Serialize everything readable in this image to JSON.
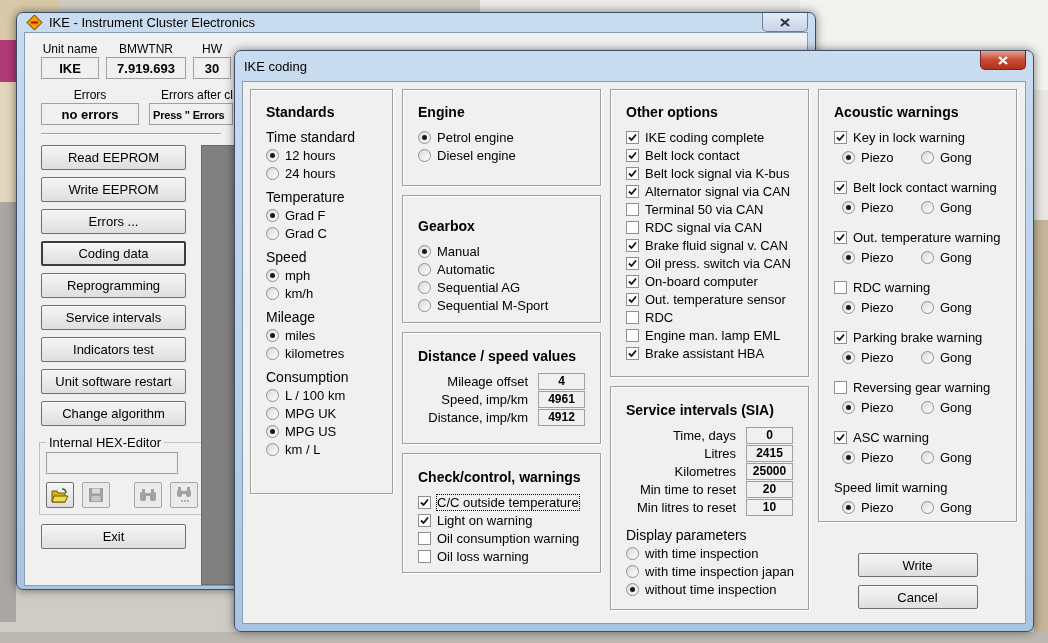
{
  "background_window": {
    "title": "IKE - Instrument Cluster Electronics",
    "info": [
      {
        "label": "Unit name",
        "value": "IKE"
      },
      {
        "label": "BMWTNR",
        "value": "7.919.693"
      },
      {
        "label": "HW",
        "value": "30"
      }
    ],
    "errors": [
      {
        "label": "Errors",
        "value": "no errors"
      },
      {
        "label": "Errors after cl",
        "value": "Press \" Errors"
      }
    ],
    "buttons": [
      {
        "label": "Read EEPROM",
        "focused": false
      },
      {
        "label": "Write EEPROM",
        "focused": false
      },
      {
        "label": "Errors ...",
        "focused": false
      },
      {
        "label": "Coding data",
        "focused": true
      },
      {
        "label": "Reprogramming",
        "focused": false
      },
      {
        "label": "Service intervals",
        "focused": false
      },
      {
        "label": "Indicators test",
        "focused": false
      },
      {
        "label": "Unit software restart",
        "focused": false
      },
      {
        "label": "Change algorithm",
        "focused": false
      }
    ],
    "hex_editor": {
      "title": "Internal HEX-Editor",
      "tools": [
        {
          "kind": "open",
          "disabled": false
        },
        {
          "kind": "save",
          "disabled": true
        },
        {
          "kind": "find",
          "disabled": true
        },
        {
          "kind": "find_next",
          "disabled": true
        }
      ]
    },
    "exit": "Exit"
  },
  "dialog": {
    "title": "IKE coding",
    "standards": {
      "title": "Standards",
      "groups": [
        {
          "label": "Time standard",
          "options": [
            {
              "label": "12 hours",
              "selected": true
            },
            {
              "label": "24 hours",
              "selected": false
            }
          ]
        },
        {
          "label": "Temperature",
          "options": [
            {
              "label": "Grad F",
              "selected": true
            },
            {
              "label": "Grad C",
              "selected": false
            }
          ]
        },
        {
          "label": "Speed",
          "options": [
            {
              "label": "mph",
              "selected": true
            },
            {
              "label": "km/h",
              "selected": false
            }
          ]
        },
        {
          "label": "Mileage",
          "options": [
            {
              "label": "miles",
              "selected": true
            },
            {
              "label": "kilometres",
              "selected": false
            }
          ]
        },
        {
          "label": "Consumption",
          "options": [
            {
              "label": "L / 100 km",
              "selected": false
            },
            {
              "label": "MPG UK",
              "selected": false
            },
            {
              "label": "MPG US",
              "selected": true
            },
            {
              "label": "km / L",
              "selected": false
            }
          ]
        }
      ]
    },
    "engine": {
      "title": "Engine",
      "options": [
        {
          "label": "Petrol engine",
          "selected": true
        },
        {
          "label": "Diesel engine",
          "selected": false
        }
      ]
    },
    "gearbox": {
      "title": "Gearbox",
      "options": [
        {
          "label": "Manual",
          "selected": true
        },
        {
          "label": "Automatic",
          "selected": false
        },
        {
          "label": "Sequential AG",
          "selected": false
        },
        {
          "label": "Sequential M-Sport",
          "selected": false
        }
      ]
    },
    "distance_speed": {
      "title": "Distance / speed values",
      "fields": [
        {
          "label": "Mileage offset",
          "value": "4"
        },
        {
          "label": "Speed, imp/km",
          "value": "4961"
        },
        {
          "label": "Distance, imp/km",
          "value": "4912"
        }
      ]
    },
    "check_control": {
      "title": "Check/control, warnings",
      "items": [
        {
          "label": "C/C outside temperature",
          "checked": true,
          "focused": true
        },
        {
          "label": "Light on warning",
          "checked": true,
          "focused": false
        },
        {
          "label": "Oil consumption warning",
          "checked": false,
          "focused": false
        },
        {
          "label": "Oil loss warning",
          "checked": false,
          "focused": false
        }
      ]
    },
    "other_options": {
      "title": "Other options",
      "items": [
        {
          "label": "IKE coding complete",
          "checked": true
        },
        {
          "label": "Belt lock contact",
          "checked": true
        },
        {
          "label": "Belt lock signal via K-bus",
          "checked": true
        },
        {
          "label": "Alternator signal via CAN",
          "checked": true
        },
        {
          "label": "Terminal 50 via CAN",
          "checked": false
        },
        {
          "label": "RDC signal via CAN",
          "checked": false
        },
        {
          "label": "Brake fluid signal v. CAN",
          "checked": true
        },
        {
          "label": "Oil press. switch via CAN",
          "checked": true
        },
        {
          "label": "On-board computer",
          "checked": true
        },
        {
          "label": "Out. temperature sensor",
          "checked": true
        },
        {
          "label": "RDC",
          "checked": false
        },
        {
          "label": "Engine man. lamp EML",
          "checked": false
        },
        {
          "label": "Brake assistant HBA",
          "checked": true
        }
      ]
    },
    "service_intervals": {
      "title": "Service intervals (SIA)",
      "fields": [
        {
          "label": "Time, days",
          "value": "0"
        },
        {
          "label": "Litres",
          "value": "2415"
        },
        {
          "label": "Kilometres",
          "value": "25000"
        },
        {
          "label": "Min time to reset",
          "value": "20"
        },
        {
          "label": "Min litres to reset",
          "value": "10"
        }
      ],
      "display_parameters": {
        "label": "Display parameters",
        "options": [
          {
            "label": "with time inspection",
            "selected": false
          },
          {
            "label": "with time inspection japan",
            "selected": false
          },
          {
            "label": "without time inspection",
            "selected": true
          }
        ]
      }
    },
    "acoustic_warnings": {
      "title": "Acoustic warnings",
      "items": [
        {
          "kind": "checkbox",
          "label": "Key in lock warning",
          "checked": true,
          "sound": [
            {
              "label": "Piezo",
              "selected": true
            },
            {
              "label": "Gong",
              "selected": false
            }
          ]
        },
        {
          "kind": "checkbox",
          "label": "Belt lock contact warning",
          "checked": true,
          "sound": [
            {
              "label": "Piezo",
              "selected": true
            },
            {
              "label": "Gong",
              "selected": false
            }
          ]
        },
        {
          "kind": "checkbox",
          "label": "Out. temperature warning",
          "checked": true,
          "sound": [
            {
              "label": "Piezo",
              "selected": true
            },
            {
              "label": "Gong",
              "selected": false
            }
          ]
        },
        {
          "kind": "checkbox",
          "label": "RDC warning",
          "checked": false,
          "sound": [
            {
              "label": "Piezo",
              "selected": true
            },
            {
              "label": "Gong",
              "selected": false
            }
          ]
        },
        {
          "kind": "checkbox",
          "label": "Parking brake warning",
          "checked": true,
          "sound": [
            {
              "label": "Piezo",
              "selected": true
            },
            {
              "label": "Gong",
              "selected": false
            }
          ]
        },
        {
          "kind": "checkbox",
          "label": "Reversing gear warning",
          "checked": false,
          "sound": [
            {
              "label": "Piezo",
              "selected": true
            },
            {
              "label": "Gong",
              "selected": false
            }
          ]
        },
        {
          "kind": "checkbox",
          "label": "ASC warning",
          "checked": true,
          "sound": [
            {
              "label": "Piezo",
              "selected": true
            },
            {
              "label": "Gong",
              "selected": false
            }
          ]
        },
        {
          "kind": "label",
          "label": "Speed limit warning",
          "sound": [
            {
              "label": "Piezo",
              "selected": true
            },
            {
              "label": "Gong",
              "selected": false
            }
          ]
        }
      ]
    },
    "buttons": [
      "Write",
      "Cancel"
    ]
  }
}
